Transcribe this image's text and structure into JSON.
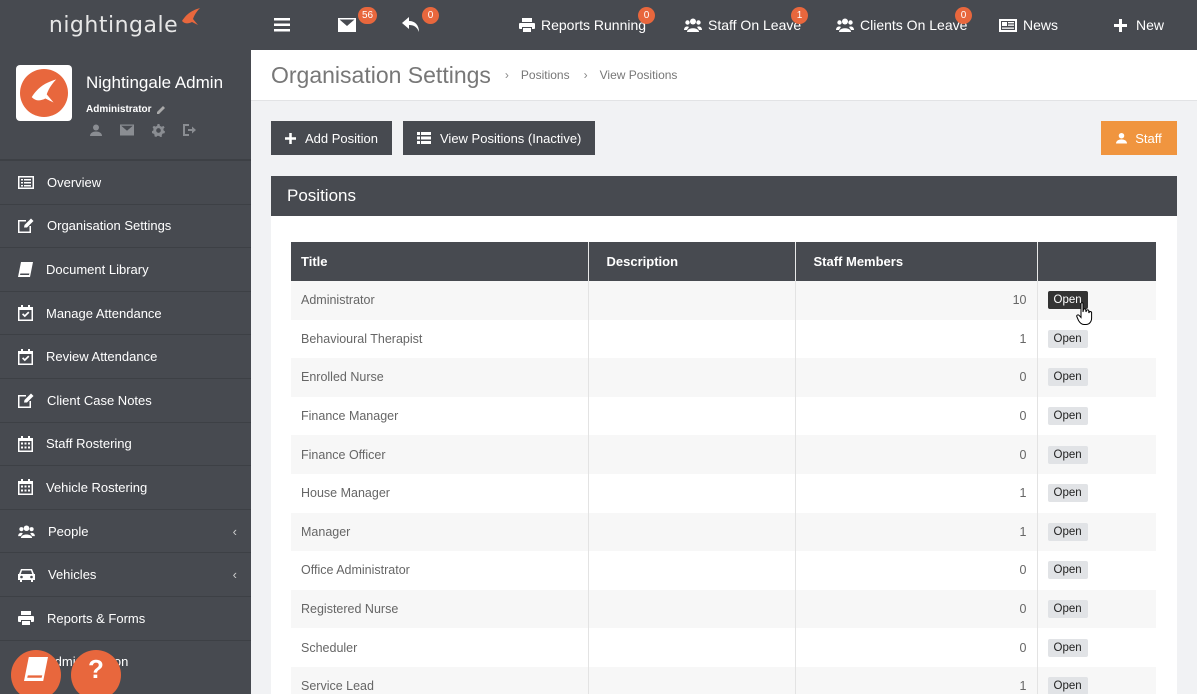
{
  "app": {
    "logo_text": "nightingale"
  },
  "topbar": {
    "messages_count": "56",
    "replies_count": "0",
    "reports_running": {
      "label": "Reports Running",
      "count": "0"
    },
    "staff_on_leave": {
      "label": "Staff On Leave",
      "count": "1"
    },
    "clients_on_leave": {
      "label": "Clients On Leave",
      "count": "0"
    },
    "news": {
      "label": "News"
    },
    "new": {
      "label": "New"
    }
  },
  "profile": {
    "name": "Nightingale Admin",
    "role": "Administrator"
  },
  "sidebar": {
    "items": [
      {
        "label": "Overview",
        "icon": "list-icon"
      },
      {
        "label": "Organisation Settings",
        "icon": "edit-icon"
      },
      {
        "label": "Document Library",
        "icon": "book-icon"
      },
      {
        "label": "Manage Attendance",
        "icon": "calendar-check-icon"
      },
      {
        "label": "Review Attendance",
        "icon": "calendar-check-icon"
      },
      {
        "label": "Client Case Notes",
        "icon": "edit-icon"
      },
      {
        "label": "Staff Rostering",
        "icon": "calendar-icon"
      },
      {
        "label": "Vehicle Rostering",
        "icon": "calendar-icon"
      },
      {
        "label": "People",
        "icon": "users-icon",
        "chevron": "‹"
      },
      {
        "label": "Vehicles",
        "icon": "car-icon",
        "chevron": "‹"
      },
      {
        "label": "Reports & Forms",
        "icon": "print-icon"
      },
      {
        "label": "Administration",
        "icon": "gear-icon"
      }
    ],
    "fab_help": "?"
  },
  "header": {
    "title": "Organisation Settings",
    "breadcrumb": [
      "Positions",
      "View Positions"
    ],
    "separator": "›"
  },
  "actions": {
    "add_position": "Add Position",
    "view_inactive": "View Positions (Inactive)",
    "staff": "Staff"
  },
  "panel": {
    "title": "Positions",
    "columns": [
      "Title",
      "Description",
      "Staff Members",
      ""
    ],
    "open_label": "Open",
    "rows": [
      {
        "title": "Administrator",
        "description": "",
        "staff": "10"
      },
      {
        "title": "Behavioural Therapist",
        "description": "",
        "staff": "1"
      },
      {
        "title": "Enrolled Nurse",
        "description": "",
        "staff": "0"
      },
      {
        "title": "Finance Manager",
        "description": "",
        "staff": "0"
      },
      {
        "title": "Finance Officer",
        "description": "",
        "staff": "0"
      },
      {
        "title": "House Manager",
        "description": "",
        "staff": "1"
      },
      {
        "title": "Manager",
        "description": "",
        "staff": "1"
      },
      {
        "title": "Office Administrator",
        "description": "",
        "staff": "0"
      },
      {
        "title": "Registered Nurse",
        "description": "",
        "staff": "0"
      },
      {
        "title": "Scheduler",
        "description": "",
        "staff": "0"
      },
      {
        "title": "Service Lead",
        "description": "",
        "staff": "1"
      }
    ]
  },
  "colors": {
    "dark": "#474a50",
    "accent": "#e8673d",
    "staff_button": "#f0953f"
  }
}
